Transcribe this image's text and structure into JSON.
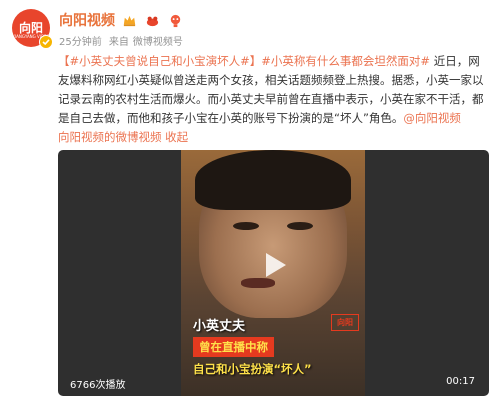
{
  "header": {
    "avatar_text": "向阳",
    "avatar_sub": "XIANGYANG VIDEO",
    "account_name": "向阳视频",
    "time": "25分钟前",
    "source_prefix": "来自",
    "source": "微博视频号"
  },
  "post": {
    "tag1": "【#小英丈夫曾说自己和小宝演坏人#】",
    "tag2": "#小英称有什么事都会坦然面对#",
    "body": " 近日，网友爆料称网红小英疑似曾送走两个女孩，相关话题频频登上热搜。据悉，小英一家以记录云南的农村生活而爆火。而小英丈夫早前曾在直播中表示，小英在家不干活，都是自己去做，而他和孩子小宝在小英的账号下扮演的是“坏人”角色。",
    "link": "@向阳视频",
    "link2": "向阳视频的微博视频",
    "collapse": "收起"
  },
  "video": {
    "caption_name": "小英丈夫",
    "caption_band": "曾在直播中称",
    "caption_quote": "自己和小宝扮演“坏人”",
    "watermark": "向阳",
    "views": "6766次播放",
    "duration": "00:17"
  }
}
